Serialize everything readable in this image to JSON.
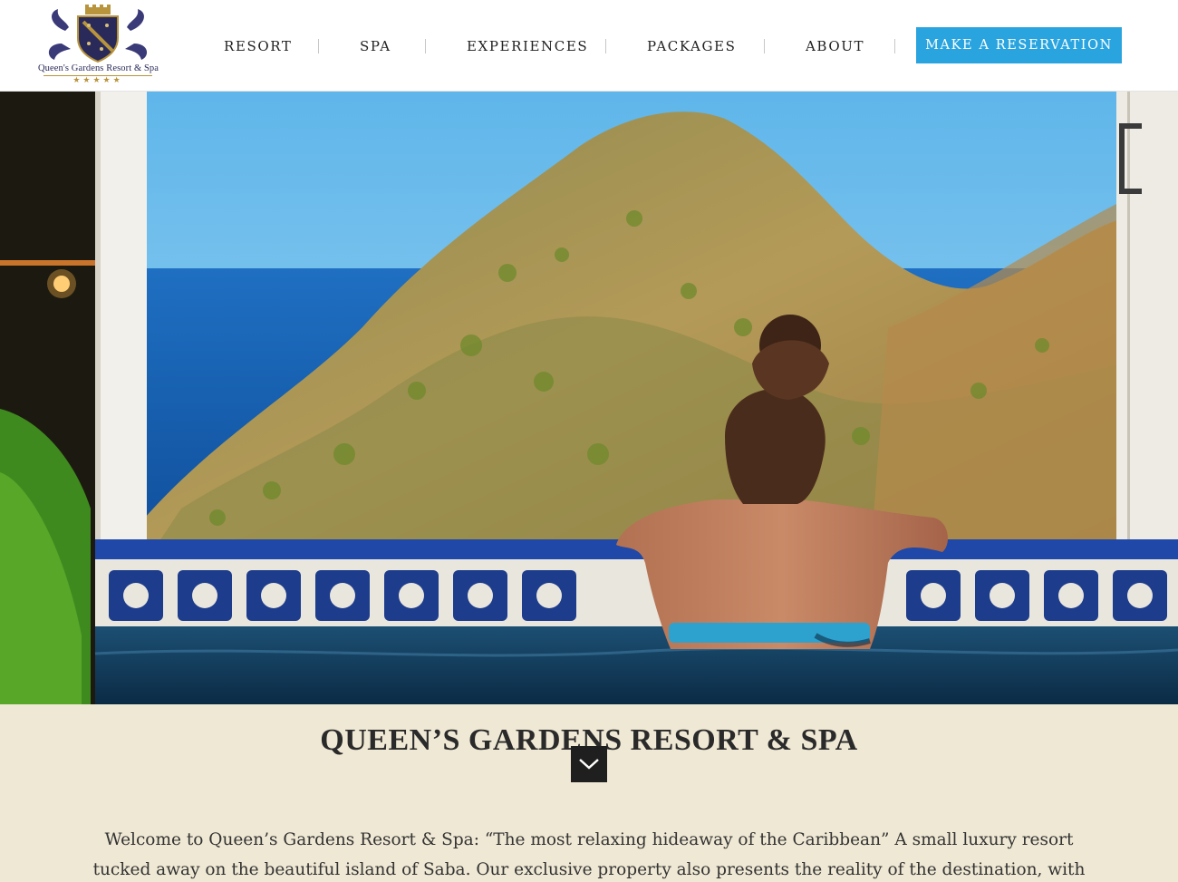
{
  "header": {
    "logo": {
      "text": "Queen's Gardens Resort & Spa",
      "stars": "★★★★★",
      "icon": "crest-logo-icon"
    },
    "nav": [
      {
        "label": "RESORT"
      },
      {
        "label": "SPA"
      },
      {
        "label": "EXPERIENCES"
      },
      {
        "label": "PACKAGES"
      },
      {
        "label": "ABOUT"
      }
    ],
    "cta_label": "MAKE A RESERVATION"
  },
  "hero": {
    "slide_count": 7,
    "current_slide": 1
  },
  "main": {
    "title": "QUEEN’S GARDENS RESORT & SPA",
    "scroll_icon": "chevron-down-icon",
    "intro_text": "Welcome to Queen’s Gardens Resort & Spa: “The most relaxing hideaway of the Caribbean” A small luxury resort tucked away on the beautiful island of Saba. Our exclusive property also presents the reality of the destination, with an architectural style"
  },
  "colors": {
    "cta": "#2aa4df",
    "page_background": "#efe8d4",
    "scroll_button": "#1f1f1f",
    "logo_gold": "#b8943c",
    "logo_navy": "#2a2a5a"
  }
}
